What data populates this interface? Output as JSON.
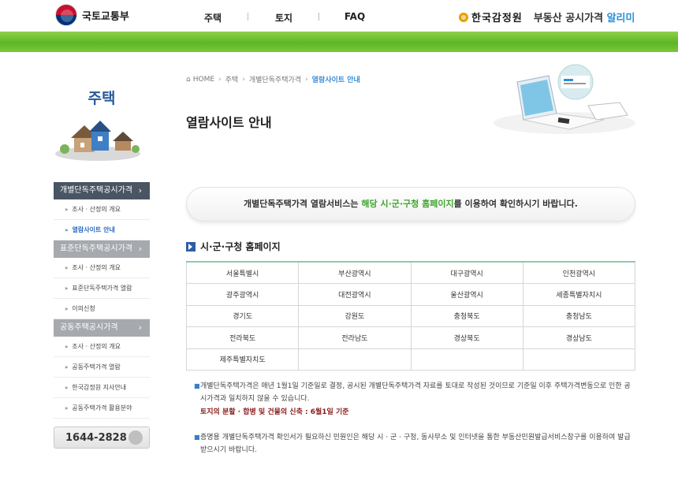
{
  "header": {
    "ministry": "국토교통부",
    "nav": [
      "주택",
      "토지",
      "FAQ"
    ],
    "brand_name": "한국감정원",
    "brand_title": "부동산 공시가격",
    "brand_accent": "알리미"
  },
  "sidebar": {
    "title": "주택",
    "groups": [
      {
        "label": "개별단독주택공시가격",
        "state": "active",
        "items": [
          {
            "label": "조사 · 산정의 개요"
          },
          {
            "label": "열람사이트 안내",
            "active": true
          }
        ]
      },
      {
        "label": "표준단독주택공시가격",
        "state": "inactive",
        "items": [
          {
            "label": "조사 · 산정의 개요"
          },
          {
            "label": "표준단독주택가격 열람"
          },
          {
            "label": "이의신청"
          }
        ]
      },
      {
        "label": "공동주택공시가격",
        "state": "inactive",
        "items": [
          {
            "label": "조사 · 산정의 개요"
          },
          {
            "label": "공동주택가격 열람"
          },
          {
            "label": "한국감정원 지사안내"
          },
          {
            "label": "공동주택가격 활용분야"
          }
        ]
      }
    ],
    "phone": "1644-2828"
  },
  "breadcrumb": [
    "HOME",
    "주택",
    "개별단독주택가격",
    "열람사이트 안내"
  ],
  "page_title": "열람사이트 안내",
  "notice": {
    "before": "개별단독주택가격 열람서비스는 ",
    "highlight": "해당 시·군·구청 홈페이지",
    "after": "를 이용하여 확인하시기 바랍니다."
  },
  "section_title": "시·군·구청 홈페이지",
  "regions": [
    [
      "서울특별시",
      "부산광역시",
      "대구광역시",
      "인천광역시"
    ],
    [
      "광주광역시",
      "대전광역시",
      "울산광역시",
      "세종특별자치시"
    ],
    [
      "경기도",
      "강원도",
      "충청북도",
      "충청남도"
    ],
    [
      "전라북도",
      "전라남도",
      "경상북도",
      "경상남도"
    ],
    [
      "제주특별자치도",
      "",
      "",
      ""
    ]
  ],
  "notes": {
    "note1": "개별단독주택가격은 매년 1월1일 기준일로 결정, 공시된 개별단독주택가격 자료를 토대로 작성된 것이므로 기준일 이후 주택가격변동으로 인한 공시가격과 일치하지 않을 수 있습니다.",
    "note1_emph": "토지의 분할 · 합병 및 건물의 신축 : 6월1일 기준",
    "note2": "증명용 개별단독주택가격 확인서가 필요하신 민원인은 해당 시 · 군 · 구청, 동사무소 및 인터넷을 통한 부동산민원발급서비스창구를 이용하여 발급 받으시기 바랍니다."
  },
  "colors": {
    "green_band": "#5cb626",
    "accent_blue": "#2a8fd8",
    "highlight_green": "#3fa42b",
    "nav_active": "#4a5563"
  }
}
